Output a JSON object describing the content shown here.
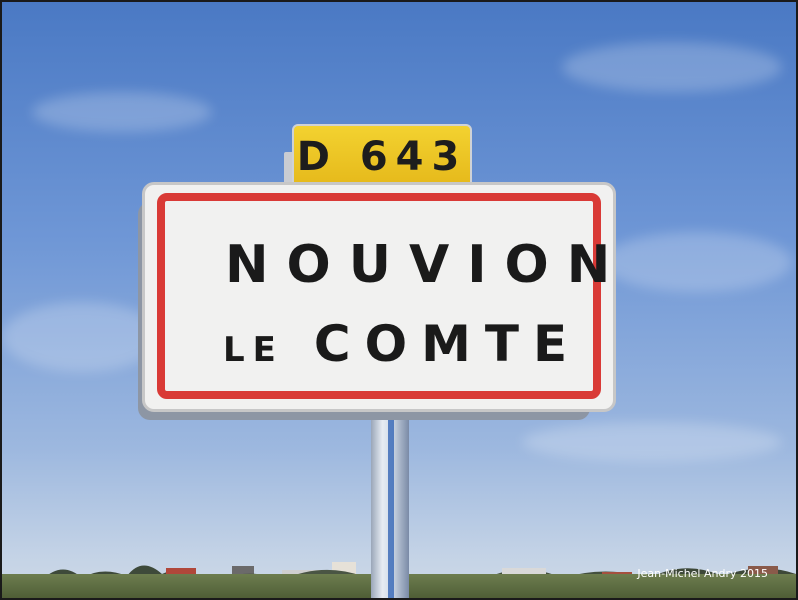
{
  "route_plate": {
    "text": "D 643"
  },
  "sign": {
    "line1": "NOUVION",
    "line2_small": "LE",
    "line2_large": "COMTE"
  },
  "credit": "Jean-Michel Andry 2015",
  "colors": {
    "sky": "#6f97d6",
    "plate": "#f3d230",
    "sign_border": "#d93a36",
    "sign_face": "#f1f1f0"
  }
}
